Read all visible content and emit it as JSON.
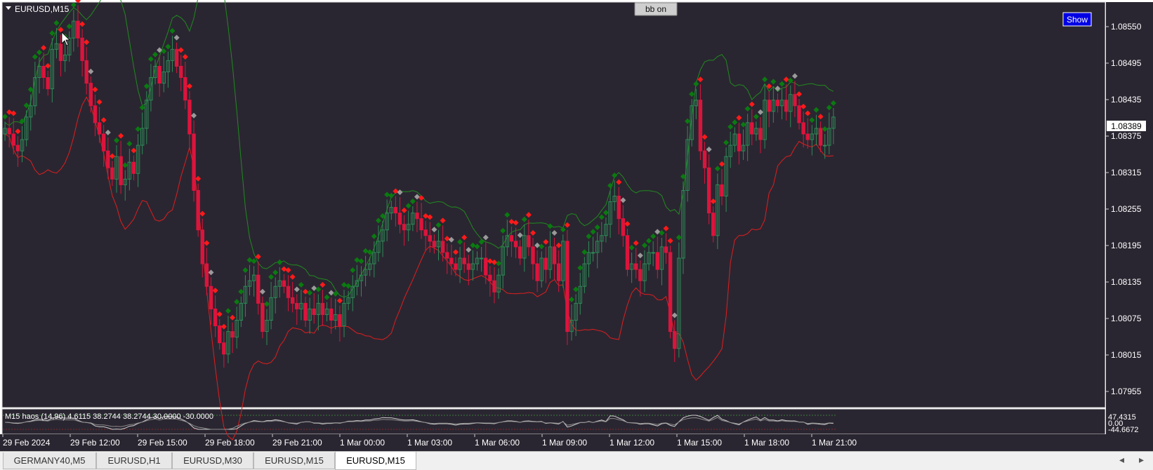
{
  "window": {
    "symbol_title": "EURUSD,M15",
    "bb_button": "bb on",
    "show_button": "Show",
    "current_price": "1.08389"
  },
  "colors": {
    "background": "#2a2631",
    "bull_candle": "#2e8b57",
    "bear_candle": "#dc143c",
    "upper_band": "#1f8a1f",
    "lower_band": "#e01e1e",
    "marker_green": "#0a7a10",
    "marker_red": "#ff1a1a",
    "marker_gray": "#9a9a9a",
    "oscillator_bright": "#2ecc71"
  },
  "price_axis": {
    "labels": [
      "1.08550",
      "1.08495",
      "1.08435",
      "1.08375",
      "1.08315",
      "1.08255",
      "1.08195",
      "1.08135",
      "1.08075",
      "1.08015",
      "1.07955"
    ]
  },
  "time_axis": {
    "labels": [
      "29 Feb 2024",
      "29 Feb 12:00",
      "29 Feb 15:00",
      "29 Feb 18:00",
      "29 Feb 21:00",
      "1 Mar 00:00",
      "1 Mar 03:00",
      "1 Mar 06:00",
      "1 Mar 09:00",
      "1 Mar 12:00",
      "1 Mar 15:00",
      "1 Mar 18:00",
      "1 Mar 21:00"
    ]
  },
  "indicator": {
    "label": "M15 haos  (14,96) 4.6115 38.2744 38.2744 30.0000 -30.0000",
    "axis_labels": [
      "47.4315",
      "0.00",
      "-44.6672"
    ]
  },
  "chart_data": {
    "type": "candlestick",
    "symbol": "EURUSD",
    "timeframe": "M15",
    "ylim": [
      1.0792,
      1.0858
    ],
    "x_labels": [
      "29 Feb 2024",
      "29 Feb 12:00",
      "29 Feb 15:00",
      "29 Feb 18:00",
      "29 Feb 21:00",
      "1 Mar 00:00",
      "1 Mar 03:00",
      "1 Mar 06:00",
      "1 Mar 09:00",
      "1 Mar 12:00",
      "1 Mar 15:00",
      "1 Mar 18:00",
      "1 Mar 21:00"
    ],
    "close": [
      1.0837,
      1.0836,
      1.0834,
      1.0833,
      1.0835,
      1.0839,
      1.0841,
      1.0846,
      1.0848,
      1.0846,
      1.0844,
      1.0851,
      1.0852,
      1.0849,
      1.085,
      1.0853,
      1.0856,
      1.0853,
      1.0849,
      1.0845,
      1.0841,
      1.0838,
      1.0836,
      1.0833,
      1.083,
      1.0828,
      1.0832,
      1.0827,
      1.0828,
      1.0831,
      1.0829,
      1.0834,
      1.0837,
      1.0842,
      1.0846,
      1.0848,
      1.0845,
      1.0847,
      1.0849,
      1.0851,
      1.0848,
      1.0846,
      1.0842,
      1.0836,
      1.0826,
      1.0819,
      1.0813,
      1.0809,
      1.0805,
      1.0802,
      1.0799,
      1.0797,
      1.0801,
      1.08,
      1.0803,
      1.0806,
      1.0809,
      1.081,
      1.0811,
      1.0806,
      1.0801,
      1.0803,
      1.0807,
      1.0809,
      1.081,
      1.0809,
      1.0807,
      1.0806,
      1.0805,
      1.0806,
      1.0803,
      1.0805,
      1.0804,
      1.0806,
      1.0804,
      1.0805,
      1.0803,
      1.0804,
      1.0802,
      1.0806,
      1.0807,
      1.0809,
      1.081,
      1.0811,
      1.0812,
      1.0813,
      1.0815,
      1.0817,
      1.0819,
      1.0822,
      1.0823,
      1.0822,
      1.082,
      1.0819,
      1.082,
      1.0822,
      1.0821,
      1.0819,
      1.0818,
      1.0817,
      1.0816,
      1.0817,
      1.0815,
      1.0814,
      1.0813,
      1.0812,
      1.0814,
      1.0813,
      1.0812,
      1.0813,
      1.0814,
      1.0814,
      1.0811,
      1.081,
      1.0808,
      1.0811,
      1.0816,
      1.0818,
      1.0817,
      1.0816,
      1.0814,
      1.0818,
      1.0816,
      1.0813,
      1.081,
      1.0814,
      1.0812,
      1.0816,
      1.0813,
      1.081,
      1.0817,
      1.0801,
      1.0803,
      1.0806,
      1.0809,
      1.0813,
      1.0815,
      1.0815,
      1.0817,
      1.0818,
      1.082,
      1.0824,
      1.0825,
      1.0821,
      1.0818,
      1.0812,
      1.0813,
      1.0812,
      1.081,
      1.0813,
      1.0815,
      1.0815,
      1.0812,
      1.0816,
      1.0815,
      1.0801,
      1.0798,
      1.0814,
      1.0826,
      1.0835,
      1.0841,
      1.0842,
      1.0833,
      1.083,
      1.0822,
      1.0818,
      1.0827,
      1.0825,
      1.0832,
      1.0834,
      1.0836,
      1.0833,
      1.0834,
      1.0838,
      1.0836,
      1.0837,
      1.0835,
      1.0842,
      1.084,
      1.0842,
      1.0841,
      1.0842,
      1.084,
      1.0843,
      1.0841,
      1.0838,
      1.0836,
      1.0835,
      1.0836,
      1.0837,
      1.0834,
      1.0834,
      1.0837,
      1.0839
    ]
  }
}
